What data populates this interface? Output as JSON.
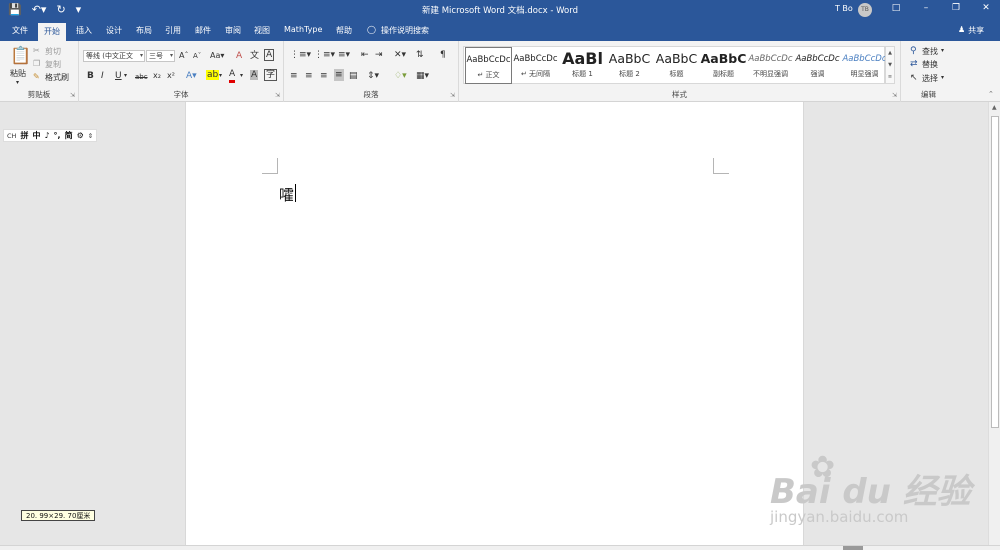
{
  "window": {
    "title": "新建 Microsoft Word 文档.docx  -  Word",
    "user_name": "T Bo",
    "avatar_initials": "TB",
    "qat": [
      "save-icon",
      "undo-icon",
      "redo-icon",
      "customize-icon"
    ]
  },
  "tabs": [
    "文件",
    "开始",
    "插入",
    "设计",
    "布局",
    "引用",
    "邮件",
    "审阅",
    "视图",
    "MathType",
    "帮助"
  ],
  "active_tab": "开始",
  "tell_me": "操作说明搜索",
  "share": "共享",
  "clipboard": {
    "paste": "粘贴",
    "cut": "剪切",
    "copy": "复制",
    "format_painter": "格式刷",
    "label": "剪贴板"
  },
  "font": {
    "font_name": "等线 (中文正文",
    "font_size": "三号",
    "label": "字体",
    "row1_buttons": [
      "A↑",
      "A↓",
      "Aa",
      "A",
      "文",
      "A"
    ],
    "row2_buttons": [
      "B",
      "I",
      "U",
      "abc",
      "x₂",
      "x²",
      "A",
      "ab",
      "A",
      "A",
      "字"
    ]
  },
  "paragraph": {
    "label": "段落"
  },
  "styles": {
    "label": "样式",
    "items": [
      {
        "sample": "AaBbCcDc",
        "name": "正文",
        "selected": true
      },
      {
        "sample": "AaBbCcDc",
        "name": "无间隔",
        "selected": false
      },
      {
        "sample": "AaBl",
        "name": "标题 1",
        "selected": false
      },
      {
        "sample": "AaBbC",
        "name": "标题 2",
        "selected": false
      },
      {
        "sample": "AaBbC",
        "name": "标题",
        "selected": false
      },
      {
        "sample": "AaBbC",
        "name": "副标题",
        "selected": false
      },
      {
        "sample": "AaBbCcDc",
        "name": "不明显强调",
        "selected": false
      },
      {
        "sample": "AaBbCcDc",
        "name": "强调",
        "selected": false
      },
      {
        "sample": "AaBbCcDc",
        "name": "明显强调",
        "selected": false
      }
    ]
  },
  "editing": {
    "find": "查找",
    "replace": "替换",
    "select": "选择",
    "label": "编辑"
  },
  "ime": {
    "mode": "CH",
    "items": [
      "拼",
      "中",
      "♪",
      "°,",
      "简",
      "⚙"
    ]
  },
  "document": {
    "text": "嚯"
  },
  "tooltip": {
    "text": "20. 99×29. 70厘米"
  },
  "watermark": {
    "brand": "Bai du 经验",
    "url": "jingyan.baidu.com"
  },
  "colors": {
    "accent": "#2b579a",
    "ribbon": "#f3f3f3",
    "canvas": "#e6e6e6"
  }
}
